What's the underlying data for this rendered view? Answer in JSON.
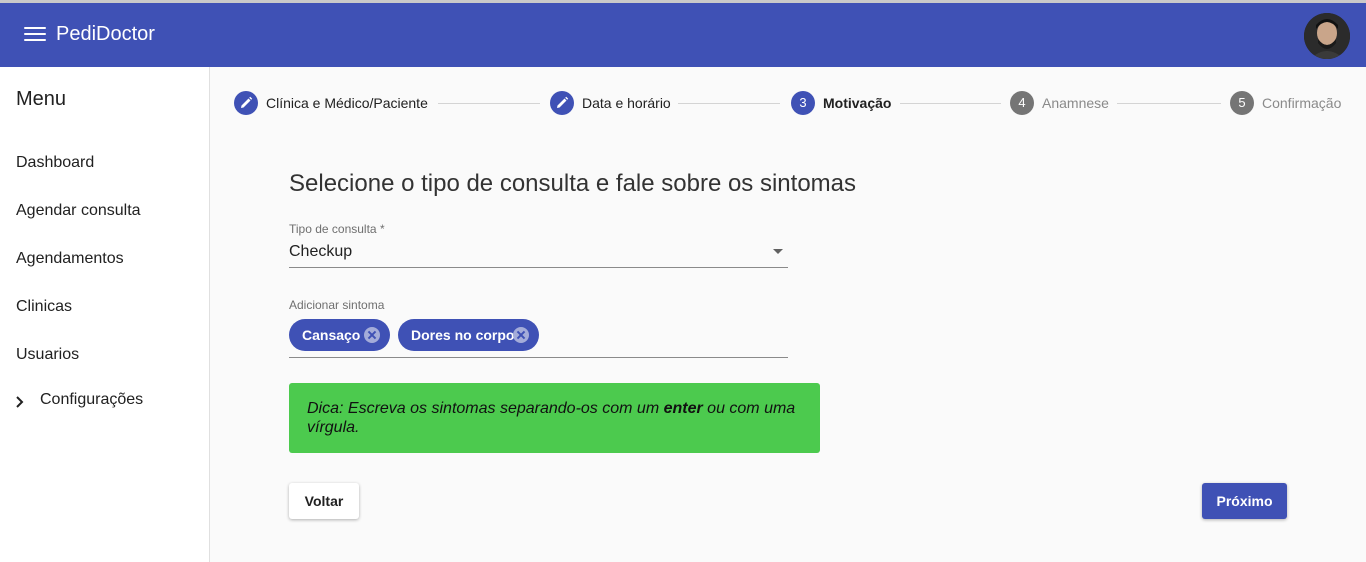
{
  "app": {
    "title": "PediDoctor"
  },
  "sidebar": {
    "title": "Menu",
    "items": [
      {
        "label": "Dashboard"
      },
      {
        "label": "Agendar consulta"
      },
      {
        "label": "Agendamentos"
      },
      {
        "label": "Clinicas"
      },
      {
        "label": "Usuarios"
      },
      {
        "label": "Configurações"
      }
    ]
  },
  "stepper": {
    "steps": [
      {
        "number": "",
        "label": "Clínica e Médico/Paciente",
        "state": "done",
        "icon": "pencil-icon"
      },
      {
        "number": "",
        "label": "Data e horário",
        "state": "done",
        "icon": "pencil-icon"
      },
      {
        "number": "3",
        "label": "Motivação",
        "state": "active"
      },
      {
        "number": "4",
        "label": "Anamnese",
        "state": "todo"
      },
      {
        "number": "5",
        "label": "Confirmação",
        "state": "todo"
      }
    ]
  },
  "form": {
    "heading": "Selecione o tipo de consulta e fale sobre os sintomas",
    "consult_type_label": "Tipo de consulta *",
    "consult_type_value": "Checkup",
    "symptoms_label": "Adicionar sintoma",
    "symptoms": [
      {
        "label": "Cansaço"
      },
      {
        "label": "Dores no corpo"
      }
    ],
    "tip_prefix": "Dica: Escreva os sintomas separando-os com um ",
    "tip_bold": "enter",
    "tip_suffix": " ou com uma vírgula."
  },
  "buttons": {
    "back": "Voltar",
    "next": "Próximo"
  },
  "colors": {
    "primary": "#3f51b5",
    "tip_bg": "#4cca4e",
    "inactive_step": "#757575"
  }
}
